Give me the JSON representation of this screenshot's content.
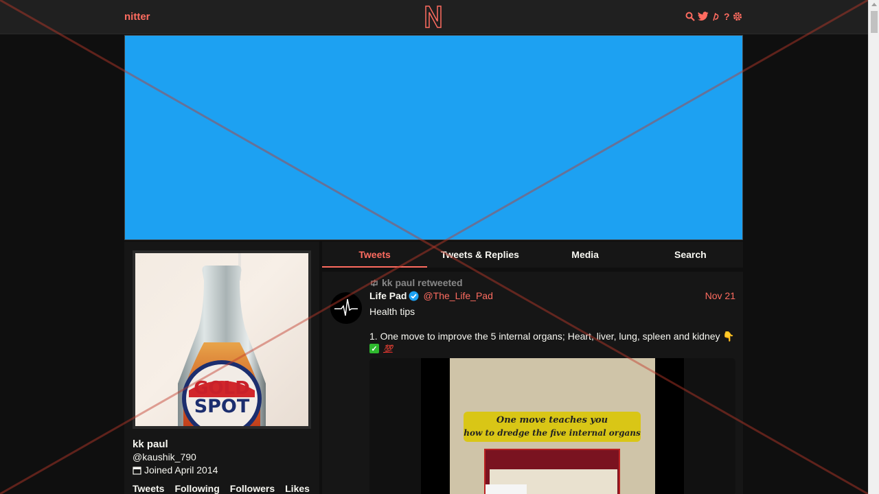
{
  "nav": {
    "brand": "nitter",
    "logo_letter": "N",
    "icons": [
      "search-icon",
      "twitter-bird-icon",
      "rss-icon",
      "help-icon",
      "gear-icon"
    ],
    "help_label": "?"
  },
  "colors": {
    "accent": "#ff6c60",
    "banner": "#1da1f2",
    "background": "#0f0f0f",
    "panel": "#161616"
  },
  "profile": {
    "name": "kk paul",
    "handle": "@kaushik_790",
    "joined": "Joined April 2014",
    "avatar_text_1": "GOLD",
    "avatar_text_2": "SPOT",
    "stats": [
      "Tweets",
      "Following",
      "Followers",
      "Likes"
    ]
  },
  "tabs": [
    {
      "label": "Tweets",
      "active": true
    },
    {
      "label": "Tweets & Replies",
      "active": false
    },
    {
      "label": "Media",
      "active": false
    },
    {
      "label": "Search",
      "active": false
    }
  ],
  "tweet": {
    "retweet_header": "kk paul retweeted",
    "fullname": "Life Pad",
    "username": "@The_Life_Pad",
    "date": "Nov 21",
    "text_line1": "Health tips",
    "text_line2": "1. One move to improve the 5 internal organs; Heart, liver, lung, spleen and kidney 👇",
    "emoji_100": "💯",
    "media_line1": "One move teaches you",
    "media_line2": "how to dredge the five internal organs"
  }
}
